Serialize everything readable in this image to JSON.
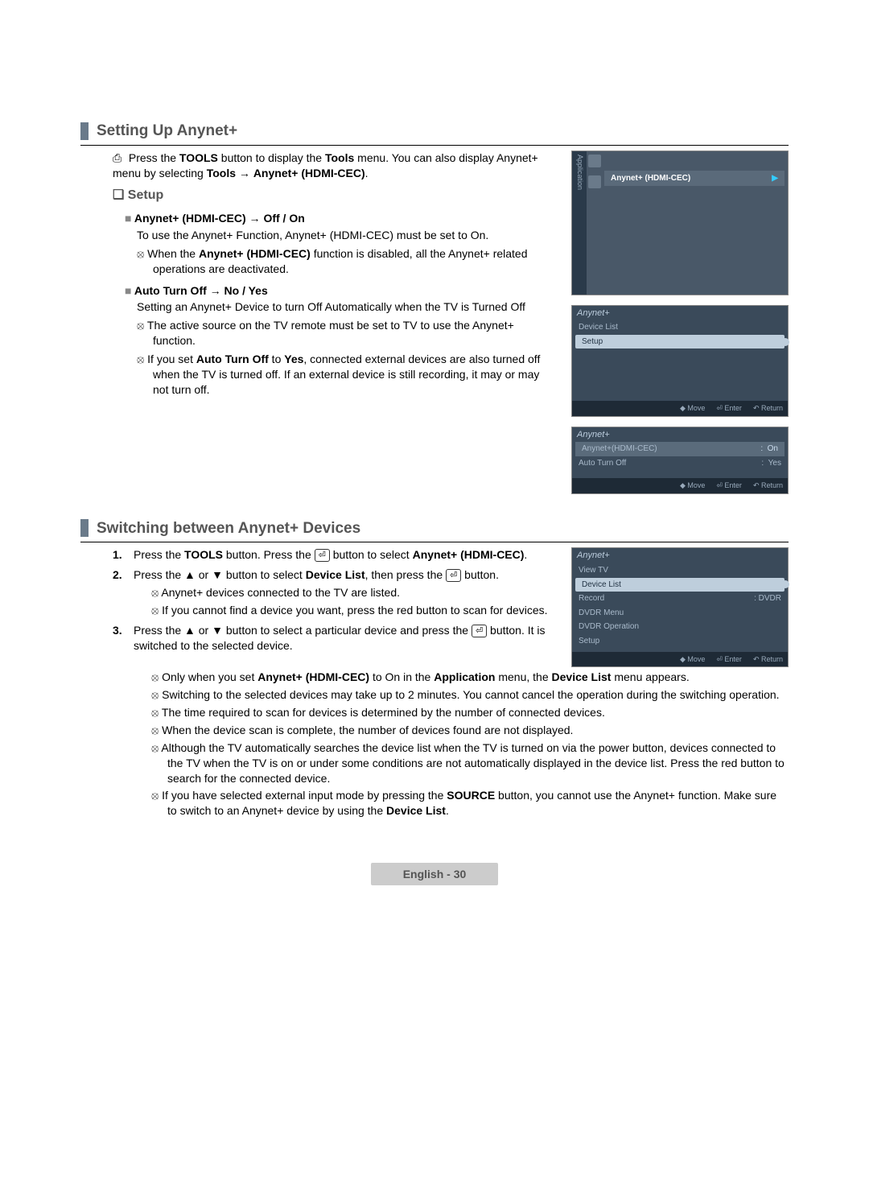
{
  "section1": {
    "title": "Setting Up Anynet+",
    "intro_prefix": "Press the ",
    "intro_bold1": "TOOLS",
    "intro_mid1": " button to display the ",
    "intro_bold2": "Tools",
    "intro_mid2": " menu. You can also display Anynet+ menu by selecting ",
    "intro_bold3": "Tools",
    "intro_arrow": " → ",
    "intro_bold4": "Anynet+ (HDMI-CEC)",
    "intro_end": ".",
    "setup_heading": "Setup",
    "sub1_heading": "Anynet+ (HDMI-CEC) → Off / On",
    "sub1_body": "To use the Anynet+ Function, Anynet+ (HDMI-CEC) must be set to On.",
    "sub1_note_pre": "When the ",
    "sub1_note_bold": "Anynet+ (HDMI-CEC)",
    "sub1_note_post": " function is disabled, all the Anynet+ related operations are deactivated.",
    "sub2_heading": "Auto Turn Off → No / Yes",
    "sub2_body": "Setting an Anynet+ Device to turn Off Automatically when the TV is Turned Off",
    "sub2_note1": "The active source on the TV remote must be set to TV to use the Anynet+ function.",
    "sub2_note2_pre": "If you set ",
    "sub2_note2_b1": "Auto Turn Off",
    "sub2_note2_mid1": " to ",
    "sub2_note2_b2": "Yes",
    "sub2_note2_post": ", connected external devices are also turned off when the TV is turned off. If an external device is still recording, it may or may not turn off."
  },
  "osd1": {
    "sidebar_label": "Application",
    "row_label": "Anynet+ (HDMI-CEC)",
    "row_arrow": "▶"
  },
  "osd2": {
    "title": "Anynet+",
    "item1": "Device List",
    "item2": "Setup",
    "footer_move": "Move",
    "footer_enter": "Enter",
    "footer_return": "Return"
  },
  "osd3": {
    "title": "Anynet+",
    "row1_label": "Anynet+(HDMI-CEC)",
    "row1_val": "On",
    "row2_label": "Auto Turn Off",
    "row2_val": "Yes",
    "footer_move": "Move",
    "footer_enter": "Enter",
    "footer_return": "Return"
  },
  "section2": {
    "title": "Switching between Anynet+ Devices",
    "s1_pre": "Press the ",
    "s1_b1": "TOOLS",
    "s1_mid": " button. Press the ",
    "s1_post": " button to select ",
    "s1_b2": "Anynet+ (HDMI-CEC)",
    "s1_end": ".",
    "s2_pre": "Press the ▲ or ▼ button to select ",
    "s2_bold": "Device List",
    "s2_mid": ", then press the ",
    "s2_post": " button.",
    "s2_note1": "Anynet+ devices connected to the TV are listed.",
    "s2_note2": "If you cannot find a device you want, press the red button to scan for devices.",
    "s3_pre": "Press the ▲ or ▼ button to select a particular device and press the ",
    "s3_post": " button. It is switched to the selected device.",
    "s3_note1_pre": "Only when you set ",
    "s3_note1_b1": "Anynet+ (HDMI-CEC)",
    "s3_note1_mid1": " to On in the ",
    "s3_note1_b2": "Application",
    "s3_note1_mid2": " menu, the ",
    "s3_note1_b3": "Device List",
    "s3_note1_post": " menu appears.",
    "s3_note2": "Switching to the selected devices may take up to 2 minutes. You cannot cancel the operation during the switching operation.",
    "s3_note3": "The time required to scan for devices is determined by the number of connected devices.",
    "s3_note4": "When the device scan is complete, the number of devices found are not displayed.",
    "s3_note5": "Although the TV automatically searches the device list when the TV is turned on via the power button, devices connected to the TV when the TV is on or under some conditions are not automatically displayed in the device list. Press the red button to search for the connected device.",
    "s3_note6_pre": "If you have selected external input mode by pressing the ",
    "s3_note6_b1": "SOURCE",
    "s3_note6_mid": " button, you cannot use the Anynet+ function. Make sure to switch to an Anynet+ device by using the ",
    "s3_note6_b2": "Device List",
    "s3_note6_post": "."
  },
  "osd4": {
    "title": "Anynet+",
    "item1": "View TV",
    "item2": "Device List",
    "item3_label": "Record",
    "item3_val": "DVDR",
    "item4": "DVDR Menu",
    "item5": "DVDR Operation",
    "item6": "Setup",
    "footer_move": "Move",
    "footer_enter": "Enter",
    "footer_return": "Return"
  },
  "footer": "English - 30",
  "enter_symbol": "⏎"
}
